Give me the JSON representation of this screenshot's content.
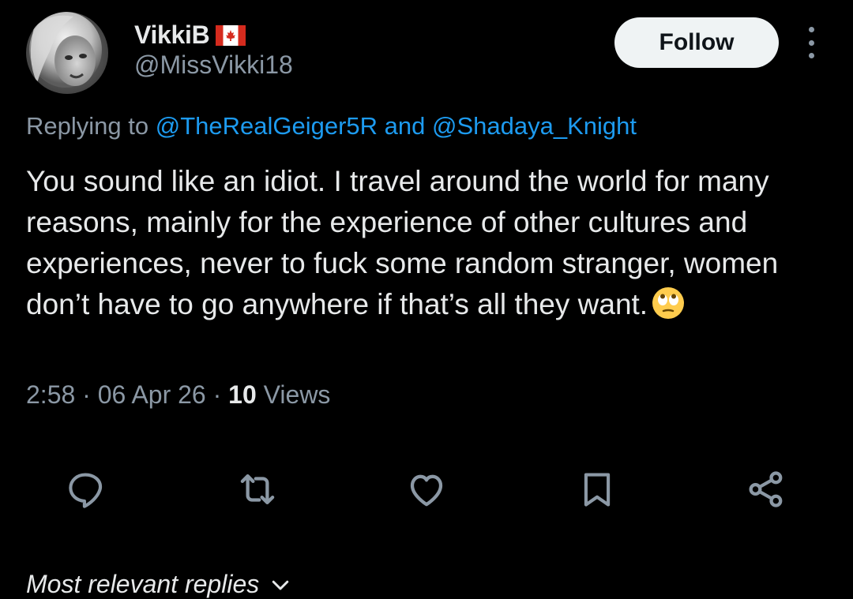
{
  "colors": {
    "background": "#000000",
    "primary_text": "#e7e9ea",
    "secondary_text": "#8b98a5",
    "link": "#1d9bf0",
    "follow_button_bg": "#eff3f4",
    "follow_button_text": "#0f1419"
  },
  "author": {
    "display_name": "VikkiB",
    "flag_icon": "canada-flag-icon",
    "handle": "@MissVikki18",
    "avatar_icon": "avatar"
  },
  "header": {
    "follow_label": "Follow",
    "more_icon": "more-vertical-icon"
  },
  "replying": {
    "prefix": "Replying to ",
    "user1": "@TheRealGeiger5R",
    "conjunction": " and ",
    "user2": "@Shadaya_Knight"
  },
  "tweet": {
    "text": "You sound like an idiot. I travel around the world for many reasons, mainly for the experience of other cultures and experiences, never to fuck some random stranger, women don’t have to go anywhere if that’s all they want.",
    "emoji_icon": "face-with-rolling-eyes-emoji"
  },
  "meta": {
    "time": "2:58",
    "separator": " · ",
    "date": "06 Apr 26",
    "views_count": "10",
    "views_label": " Views"
  },
  "actions": [
    {
      "name": "reply",
      "icon": "reply-icon"
    },
    {
      "name": "repost",
      "icon": "repost-icon"
    },
    {
      "name": "like",
      "icon": "heart-icon"
    },
    {
      "name": "bookmark",
      "icon": "bookmark-icon"
    },
    {
      "name": "share",
      "icon": "share-icon"
    }
  ],
  "replies_section": {
    "label": "Most relevant replies",
    "icon": "chevron-down-icon"
  }
}
